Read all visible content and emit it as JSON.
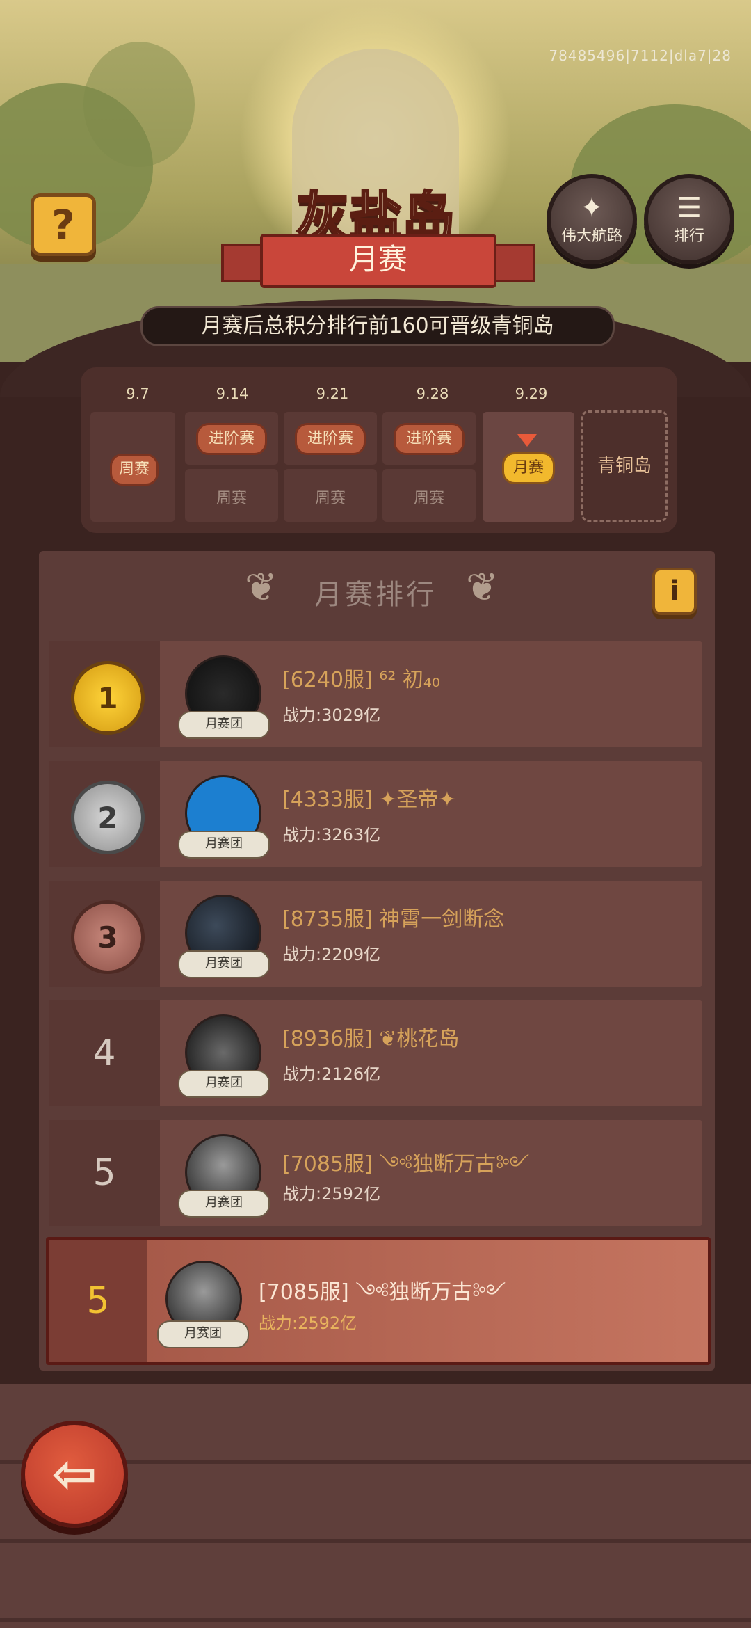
{
  "version": "78485496|7112|dla7|28",
  "header": {
    "title": "灰盐岛",
    "subtitle": "月赛",
    "rule": "月赛后总积分排行前160可晋级青铜岛",
    "help_icon": "question-icon",
    "voyage_button": {
      "label": "伟大航路",
      "icon": "map-icon"
    },
    "rank_button": {
      "label": "排行",
      "icon": "list-icon"
    }
  },
  "timeline": {
    "dates": [
      "9.7",
      "9.14",
      "9.21",
      "9.28",
      "9.29"
    ],
    "stages": [
      {
        "main": "周赛",
        "sub": ""
      },
      {
        "main": "进阶赛",
        "sub": "周赛"
      },
      {
        "main": "进阶赛",
        "sub": "周赛"
      },
      {
        "main": "进阶赛",
        "sub": "周赛"
      },
      {
        "main": "月赛",
        "sub": ""
      }
    ],
    "next_island": "青铜岛"
  },
  "ranking": {
    "title": "月赛排行",
    "info_icon": "info-icon",
    "badge_label": "月赛团",
    "rows": [
      {
        "rank": "1",
        "name": "[6240服] ⁶² 初₄₀",
        "power": "战力:3029亿"
      },
      {
        "rank": "2",
        "name": "[4333服] ✦圣帝✦",
        "power": "战力:3263亿"
      },
      {
        "rank": "3",
        "name": "[8735服] 神霄一剑断念",
        "power": "战力:2209亿"
      },
      {
        "rank": "4",
        "name": "[8936服] ❦桃花岛",
        "power": "战力:2126亿"
      },
      {
        "rank": "5",
        "name": "[7085服] ༺独断万古༻",
        "power": "战力:2592亿"
      }
    ],
    "self": {
      "rank": "5",
      "name": "[7085服] ༺独断万古༻",
      "power": "战力:2592亿"
    }
  },
  "footer": {
    "back_icon": "back-arrow-icon"
  },
  "colors": {
    "gold": "#f0b53a",
    "panel": "#5c3c38",
    "highlight": "#c57560",
    "name": "#d6a25a"
  }
}
